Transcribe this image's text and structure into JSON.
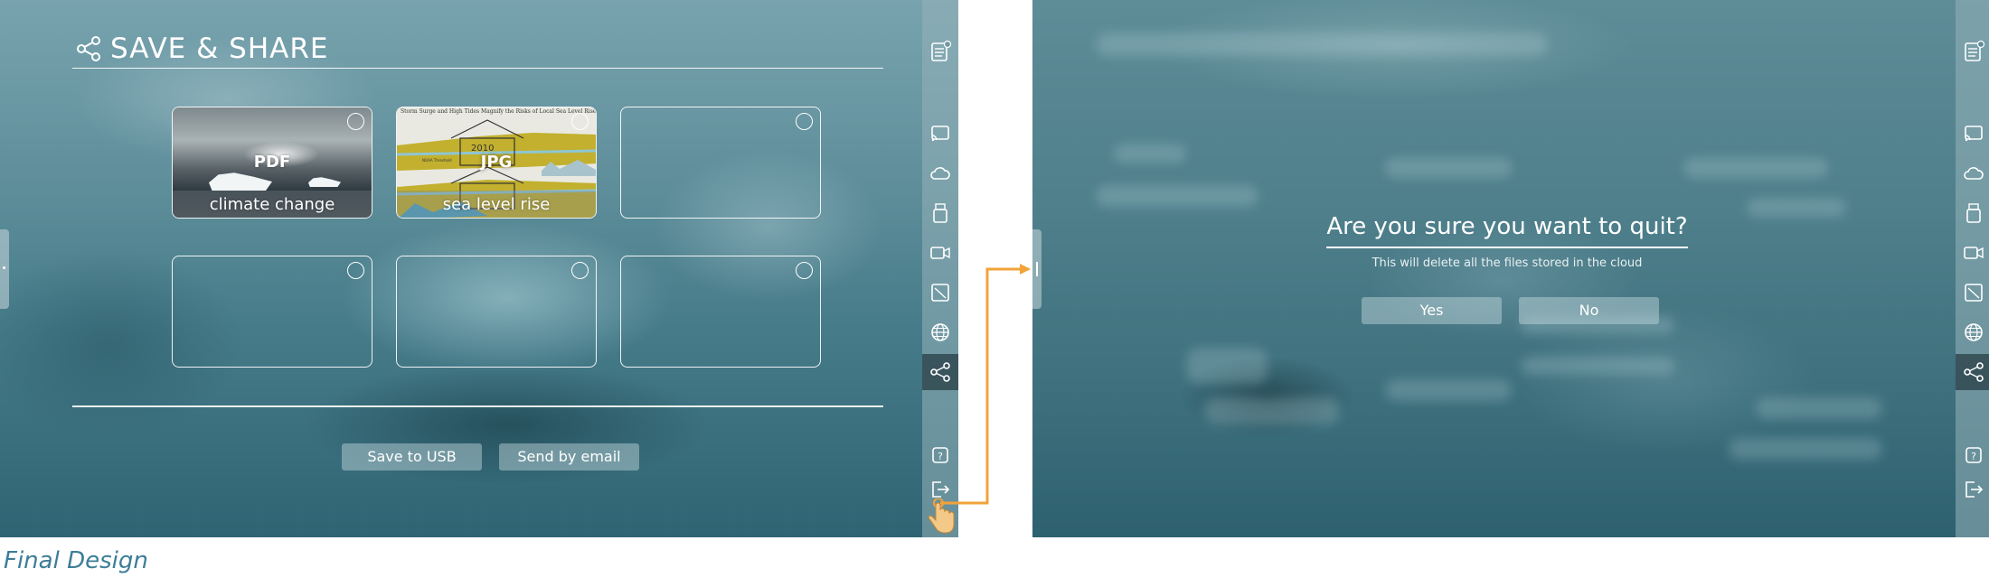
{
  "left_screen": {
    "title": "SAVE & SHARE",
    "files": [
      {
        "format": "PDF",
        "caption": "climate change",
        "kind": "climate"
      },
      {
        "format": "JPG",
        "caption": "sea level rise",
        "kind": "sea",
        "headline": "Storm Surge and High Tides Magnify the Risks of Local Sea Level Rise",
        "year": "2010",
        "note": "NOAA Threshold"
      },
      {
        "format": "",
        "caption": "",
        "kind": "empty"
      },
      {
        "format": "",
        "caption": "",
        "kind": "empty"
      },
      {
        "format": "",
        "caption": "",
        "kind": "empty"
      },
      {
        "format": "",
        "caption": "",
        "kind": "empty"
      }
    ],
    "actions": {
      "save_usb": "Save to USB",
      "send_email": "Send by email"
    }
  },
  "sidebar_icons": [
    "notes-icon",
    "cast-icon",
    "cloud-icon",
    "usb-icon",
    "video-icon",
    "ruler-icon",
    "globe-icon",
    "share-icon",
    "help-icon",
    "exit-icon"
  ],
  "dialog": {
    "title": "Are you sure you want to quit?",
    "message": "This will delete all the files stored in the cloud",
    "yes_label": "Yes",
    "no_label": "No"
  },
  "caption": "Final Design",
  "colors": {
    "accent_arrow": "#f2a33a",
    "caption": "#3d7d97",
    "active_sidebar": "#2e4b55"
  }
}
